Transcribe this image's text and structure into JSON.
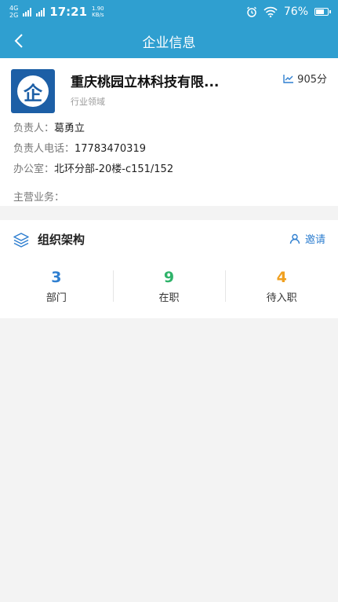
{
  "status_bar": {
    "network_top": "4G",
    "network_bottom": "2G",
    "time": "17:21",
    "speed_value": "1.90",
    "speed_unit": "KB/s",
    "battery": "76%"
  },
  "nav": {
    "title": "企业信息"
  },
  "company": {
    "logo_char": "企",
    "name": "重庆桃园立林科技有限...",
    "score": "905分",
    "industry_label": "行业领域",
    "manager_label": "负责人：",
    "manager": "葛勇立",
    "phone_label": "负责人电话：",
    "phone": "17783470319",
    "office_label": "办公室：",
    "office": "北环分部-20楼-c151/152",
    "business_label": "主营业务："
  },
  "org": {
    "title": "组织架构",
    "invite_label": "邀请",
    "stats": [
      {
        "value": "3",
        "label": "部门",
        "color": "#2f7fd0"
      },
      {
        "value": "9",
        "label": "在职",
        "color": "#2fb36a"
      },
      {
        "value": "4",
        "label": "待入职",
        "color": "#f0a020"
      }
    ]
  }
}
